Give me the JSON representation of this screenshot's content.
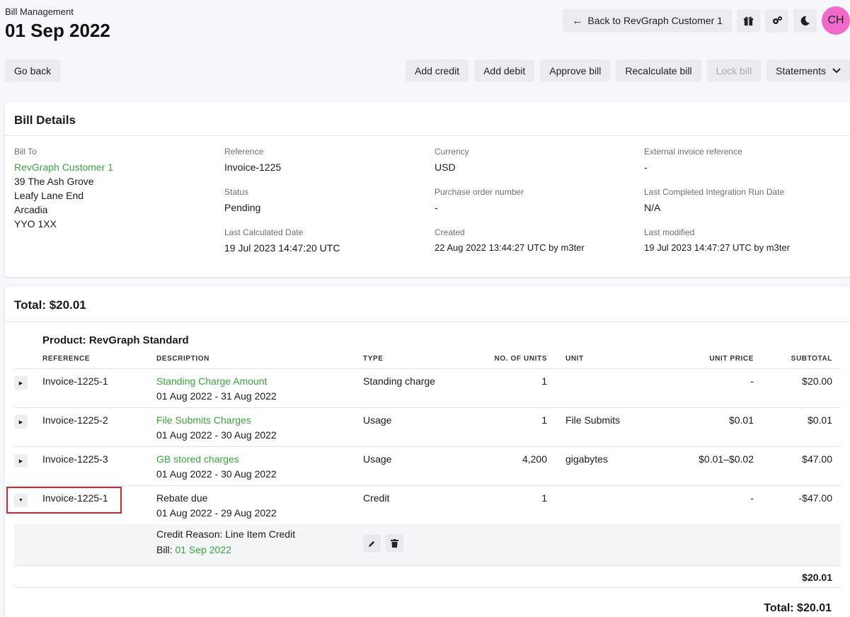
{
  "header": {
    "section": "Bill Management",
    "title": "01 Sep 2022",
    "back_link": "Back to RevGraph Customer 1",
    "avatar_initials": "CH",
    "avatar_color": "#f06ac9"
  },
  "toolbar": {
    "go_back": "Go back",
    "add_credit": "Add credit",
    "add_debit": "Add debit",
    "approve_bill": "Approve bill",
    "recalculate_bill": "Recalculate bill",
    "lock_bill": "Lock bill",
    "statements": "Statements"
  },
  "bill_details": {
    "title": "Bill Details",
    "bill_to_label": "Bill To",
    "bill_to_name": "RevGraph Customer 1",
    "address": [
      "39 The Ash Grove",
      "Leafy Lane End",
      "Arcadia",
      "YYO 1XX"
    ],
    "reference_label": "Reference",
    "reference": "Invoice-1225",
    "status_label": "Status",
    "status": "Pending",
    "last_calculated_label": "Last Calculated Date",
    "last_calculated": "19 Jul 2023 14:47:20 UTC",
    "currency_label": "Currency",
    "currency": "USD",
    "po_label": "Purchase order number",
    "po": "-",
    "created_label": "Created",
    "created": "22 Aug 2022 13:44:27 UTC by m3ter",
    "ext_ref_label": "External invoice reference",
    "ext_ref": "-",
    "last_integration_label": "Last Completed Integration Run Date",
    "last_integration": "N/A",
    "last_modified_label": "Last modified",
    "last_modified": "19 Jul 2023 14:47:27 UTC by m3ter"
  },
  "totals": {
    "title": "Total: $20.01",
    "product": "Product: RevGraph Standard",
    "columns": [
      "REFERENCE",
      "DESCRIPTION",
      "TYPE",
      "NO. OF UNITS",
      "UNIT",
      "UNIT PRICE",
      "SUBTOTAL"
    ],
    "rows": [
      {
        "ref": "Invoice-1225-1",
        "desc": "Standing Charge Amount",
        "period": "01 Aug 2022 - 31 Aug 2022",
        "type": "Standing charge",
        "units": "1",
        "unit": "",
        "price": "-",
        "subtotal": "$20.00"
      },
      {
        "ref": "Invoice-1225-2",
        "desc": "File Submits Charges",
        "period": "01 Aug 2022 - 30 Aug 2022",
        "type": "Usage",
        "units": "1",
        "unit": "File Submits",
        "price": "$0.01",
        "subtotal": "$0.01"
      },
      {
        "ref": "Invoice-1225-3",
        "desc": "GB stored charges",
        "period": "01 Aug 2022 - 30 Aug 2022",
        "type": "Usage",
        "units": "4,200",
        "unit": "gigabytes",
        "price": "$0.01–$0.02",
        "subtotal": "$47.00"
      },
      {
        "ref": "Invoice-1225-1",
        "desc": "Rebate due",
        "period": "01 Aug 2022 - 29 Aug 2022",
        "type": "Credit",
        "units": "1",
        "unit": "",
        "price": "-",
        "subtotal": "-$47.00"
      }
    ],
    "credit_reason": "Credit Reason: Line Item Credit",
    "bill_label": "Bill:",
    "bill_link": "01 Sep 2022",
    "section_sum": "$20.01",
    "grand_total": "Total: $20.01"
  },
  "colors": {
    "accent_green": "#3aa53d",
    "highlight_red": "#d9232a"
  }
}
